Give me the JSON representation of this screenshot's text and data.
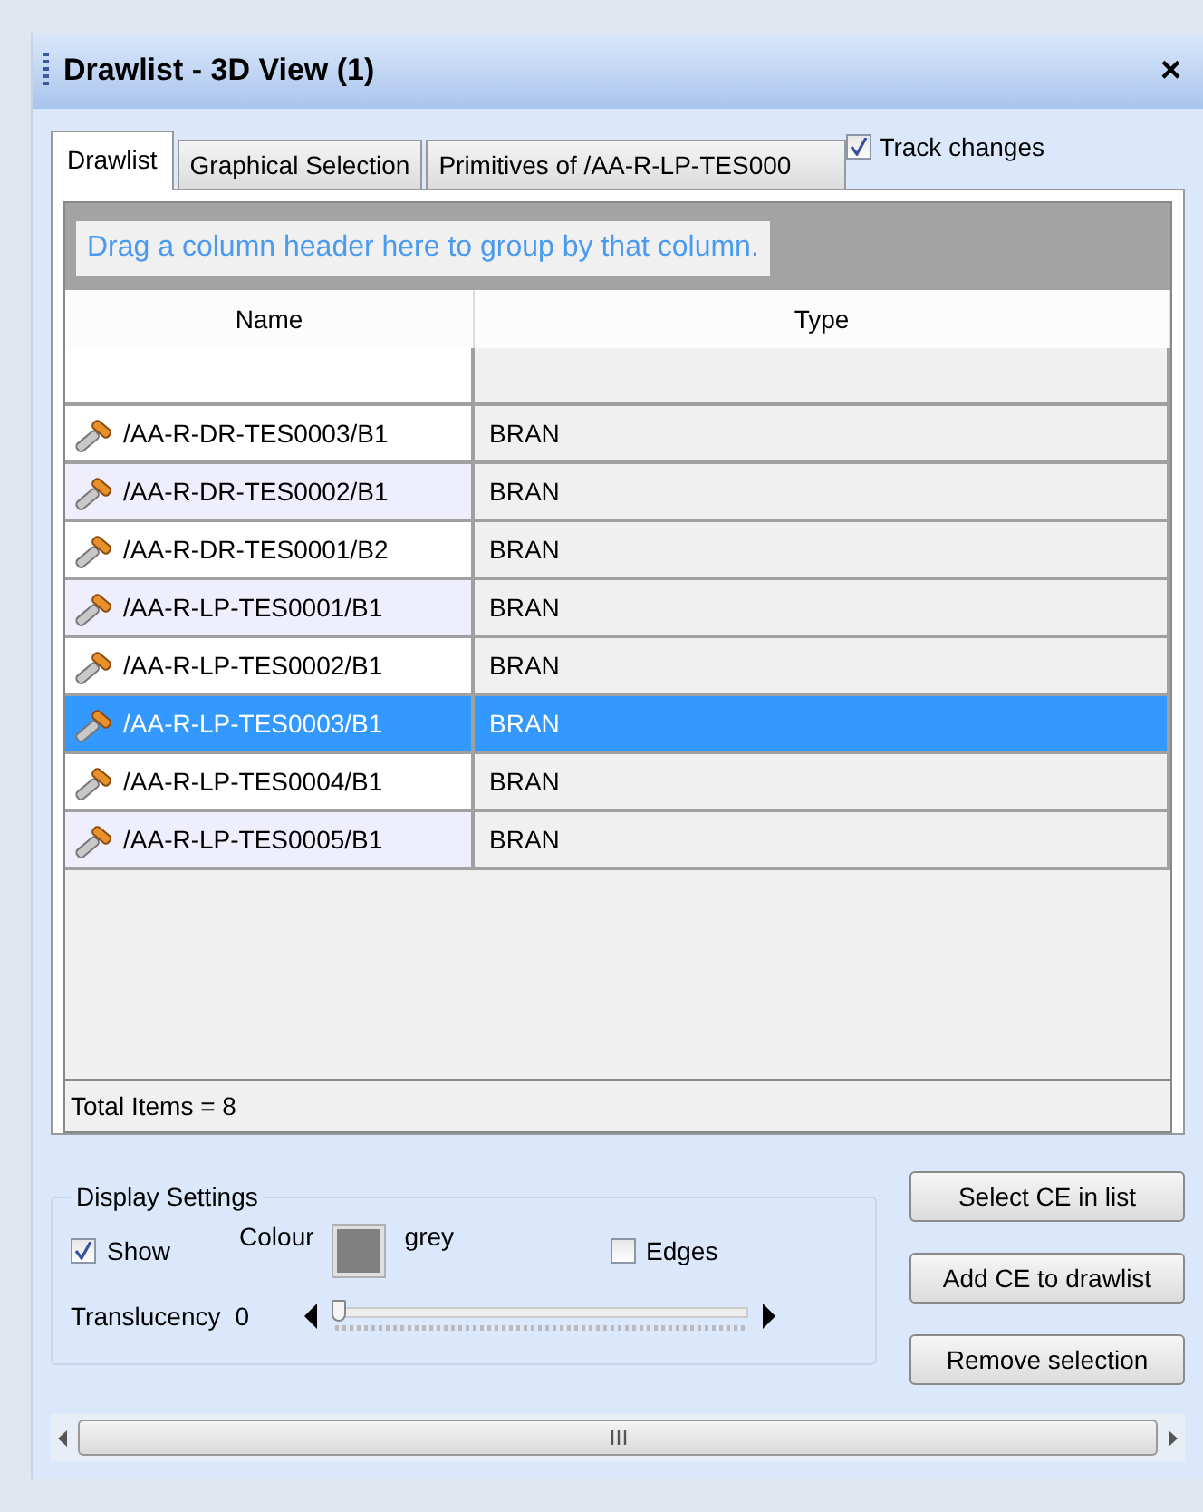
{
  "window": {
    "title": "Drawlist - 3D View (1)",
    "close": "×"
  },
  "tabs": [
    {
      "label": "Drawlist",
      "selected": true
    },
    {
      "label": "Graphical Selection",
      "selected": false
    },
    {
      "label": "Primitives of /AA-R-LP-TES000",
      "selected": false
    }
  ],
  "track_changes": {
    "label": "Track changes",
    "checked": true
  },
  "group_panel": {
    "hint": "Drag a column header here to group by that column."
  },
  "table": {
    "columns": [
      "Name",
      "Type"
    ],
    "rows": [
      {
        "name": "/AA-R-DR-TES0003/B1",
        "type": "BRAN",
        "selected": false
      },
      {
        "name": "/AA-R-DR-TES0002/B1",
        "type": "BRAN",
        "selected": false
      },
      {
        "name": "/AA-R-DR-TES0001/B2",
        "type": "BRAN",
        "selected": false
      },
      {
        "name": "/AA-R-LP-TES0001/B1",
        "type": "BRAN",
        "selected": false
      },
      {
        "name": "/AA-R-LP-TES0002/B1",
        "type": "BRAN",
        "selected": false
      },
      {
        "name": "/AA-R-LP-TES0003/B1",
        "type": "BRAN",
        "selected": true
      },
      {
        "name": "/AA-R-LP-TES0004/B1",
        "type": "BRAN",
        "selected": false
      },
      {
        "name": "/AA-R-LP-TES0005/B1",
        "type": "BRAN",
        "selected": false
      }
    ],
    "footer": "Total Items = 8"
  },
  "display_settings": {
    "title": "Display Settings",
    "show": {
      "label": "Show",
      "checked": true
    },
    "colour_label": "Colour",
    "colour_name": "grey",
    "edges": {
      "label": "Edges",
      "checked": false
    },
    "translucency_label": "Translucency",
    "translucency_value": "0",
    "translucency": {
      "level": 0
    }
  },
  "buttons": [
    "Select CE in list",
    "Add CE to drawlist",
    "Remove selection"
  ]
}
